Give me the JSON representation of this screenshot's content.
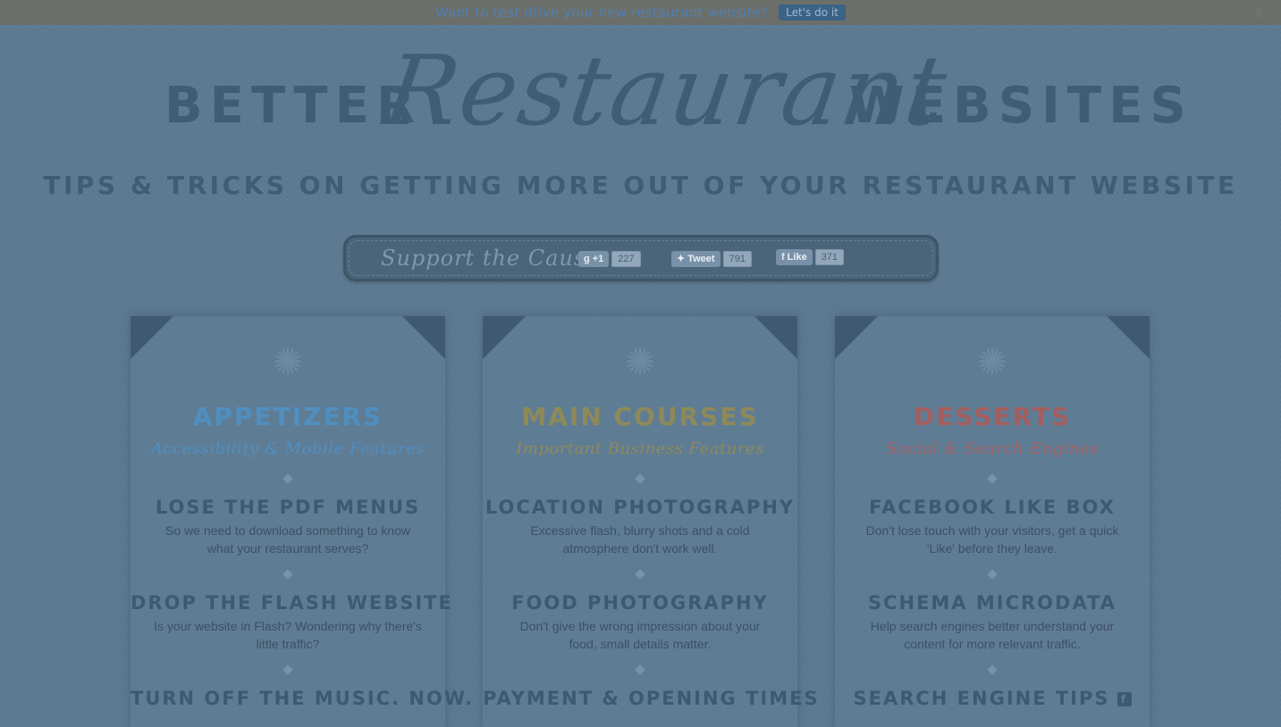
{
  "topbar": {
    "message": "Want to test drive your new restaurant website?",
    "button_label": "Let's do it"
  },
  "hero": {
    "word_left": "BETTER",
    "word_script": "Restaurant",
    "word_right": "WEBSITES"
  },
  "tagline": "TIPS & TRICKS ON GETTING MORE OUT OF YOUR RESTAURANT WEBSITE",
  "support": {
    "label": "Support the Cause",
    "gplus": {
      "label": "+1",
      "count": "227"
    },
    "tweet": {
      "label": "Tweet",
      "count": "791"
    },
    "like": {
      "label": "Like",
      "count": "371"
    }
  },
  "colors": {
    "appetizers": "#4f8fc0",
    "main_courses": "#8e8a58",
    "desserts": "#a35f5f"
  },
  "cards": [
    {
      "title": "APPETIZERS",
      "subtitle": "Accessibility & Mobile Features",
      "items": [
        {
          "heading": "LOSE THE PDF MENUS",
          "text": "So we need to download something to know what your restaurant serves?"
        },
        {
          "heading": "DROP THE FLASH WEBSITE",
          "text": "Is your website in Flash? Wondering why there's little traffic?"
        },
        {
          "heading": "TURN OFF THE MUSIC. NOW.",
          "text": ""
        }
      ]
    },
    {
      "title": "MAIN COURSES",
      "subtitle": "Important Business Features",
      "items": [
        {
          "heading": "LOCATION PHOTOGRAPHY",
          "text": "Excessive flash, blurry shots and a cold atmosphere don't work well."
        },
        {
          "heading": "FOOD PHOTOGRAPHY",
          "text": "Don't give the wrong impression about your food, small details matter."
        },
        {
          "heading": "PAYMENT & OPENING TIMES",
          "text": ""
        }
      ]
    },
    {
      "title": "DESSERTS",
      "subtitle": "Social & Search Engines",
      "items": [
        {
          "heading": "FACEBOOK LIKE BOX",
          "text": "Don't lose touch with your visitors, get a quick 'Like' before they leave."
        },
        {
          "heading": "SCHEMA MICRODATA",
          "text": "Help search engines better understand your content for more relevant traffic."
        },
        {
          "heading": "SEARCH ENGINE TIPS",
          "text": ""
        }
      ]
    }
  ]
}
